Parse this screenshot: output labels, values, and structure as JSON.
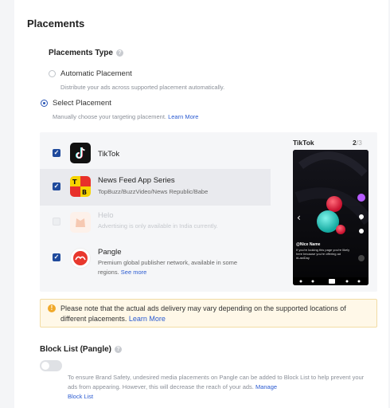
{
  "section": {
    "title": "Placements"
  },
  "placements_type": {
    "label": "Placements Type",
    "automatic": {
      "label": "Automatic Placement",
      "desc": "Distribute your ads across supported placement automatically.",
      "selected": false
    },
    "select": {
      "label": "Select Placement",
      "desc": "Manually choose your targeting placement.",
      "link": "Learn More",
      "selected": true
    }
  },
  "placements": [
    {
      "name": "TikTok",
      "checked": true,
      "enabled": true
    },
    {
      "name": "News Feed App Series",
      "sub": "TopBuzz/BuzzVideo/News Republic/Babe",
      "checked": true,
      "enabled": true
    },
    {
      "name": "Helo",
      "sub": "Advertising is only available in India currently.",
      "checked": false,
      "enabled": false
    },
    {
      "name": "Pangle",
      "sub_1": "Premium global publisher network, available in some",
      "sub_2": "regions.",
      "link": "See more",
      "checked": true,
      "enabled": true
    }
  ],
  "preview": {
    "title": "TikTok",
    "page_current": "2",
    "page_total": "/3",
    "user": "@Nice Name",
    "caption": "If you're looking this page you're likely here because you're offering ad #LastDay"
  },
  "notice": {
    "text": "Please note that the actual ads delivery may vary depending on the supported locations of different placements.",
    "link": "Learn More"
  },
  "block_list": {
    "label": "Block List (Pangle)",
    "desc": "To ensure Brand Safety, undesired media placements on Pangle can be added to Block List to help prevent your ads from appearing. However, this will decrease the reach of your ads.",
    "link_1": "Manage",
    "link_2": "Block List",
    "enabled": false
  },
  "colors": {
    "accent": "#2854b5",
    "link": "#2b5bd1",
    "warning": "#f0a92a"
  }
}
